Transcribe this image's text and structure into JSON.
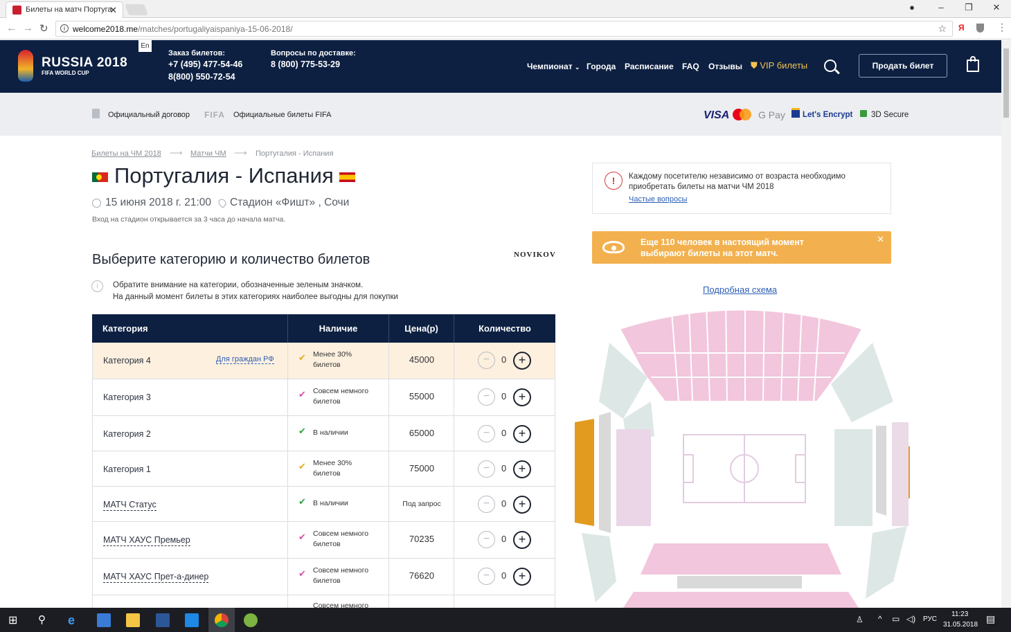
{
  "browser": {
    "tab_title": "Билеты на матч Португа",
    "url_host": "welcome2018.me",
    "url_path": "/matches/portugaliyaispaniya-15-06-2018/"
  },
  "header": {
    "logo_title": "RUSSIA 2018",
    "logo_subtitle": "FIFA WORLD CUP",
    "lang": "En",
    "order_label": "Заказ билетов:",
    "order_phone1": "+7 (495) 477-54-46",
    "order_phone2": "8(800) 550-72-54",
    "delivery_label": "Вопросы по доставке:",
    "delivery_phone": "8 (800) 775-53-29",
    "menu": [
      "Чемпионат",
      "Города",
      "Расписание",
      "FAQ",
      "Отзывы",
      "VIP билеты"
    ],
    "sell_button": "Продать билет"
  },
  "trust_bar": {
    "contract": "Официальный договор",
    "fifa_mark": "FIFA",
    "fifa_tickets": "Официальные билеты FIFA",
    "visa": "VISA",
    "gpay": "G Pay",
    "lets_encrypt": "Let's Encrypt",
    "secure3d": "3D Secure"
  },
  "breadcrumbs": [
    "Билеты на ЧМ 2018",
    "Матчи ЧМ",
    "Португалия - Испания"
  ],
  "match": {
    "title": "Португалия - Испания",
    "datetime": "15 июня 2018 г. 21:00",
    "stadium": "Стадион «Фишт» , Сочи",
    "entry_note": "Вход на стадион открывается за 3 часа до начала матча."
  },
  "choose_heading": "Выберите категорию и количество билетов",
  "sponsor": "NOVIKOV",
  "attention": {
    "line1": "Обратите внимание на категории, обозначенные зеленым значком.",
    "line2": "На данный момент билеты в этих категориях наиболее выгодны для покупки"
  },
  "table": {
    "headers": [
      "Категория",
      "Наличие",
      "Цена(р)",
      "Количество"
    ],
    "rf_link": "Для граждан РФ",
    "rows": [
      {
        "category": "Категория 4",
        "avail1": "Менее 30%",
        "avail2": "билетов",
        "price": "45000",
        "qty": "0"
      },
      {
        "category": "Категория 3",
        "avail1": "Совсем немного",
        "avail2": "билетов",
        "price": "55000",
        "qty": "0"
      },
      {
        "category": "Категория 2",
        "avail1": "В наличии",
        "avail2": "",
        "price": "65000",
        "qty": "0"
      },
      {
        "category": "Категория 1",
        "avail1": "Менее 30%",
        "avail2": "билетов",
        "price": "75000",
        "qty": "0"
      },
      {
        "category": "МАТЧ Статус",
        "avail1": "В наличии",
        "avail2": "",
        "price": "Под запрос",
        "qty": "0"
      },
      {
        "category": "МАТЧ ХАУС Премьер",
        "avail1": "Совсем немного",
        "avail2": "билетов",
        "price": "70235",
        "qty": "0"
      },
      {
        "category": "МАТЧ ХАУС Прет-а-динер",
        "avail1": "Совсем немного",
        "avail2": "билетов",
        "price": "76620",
        "qty": "0"
      },
      {
        "category": "",
        "avail1": "Совсем немного",
        "avail2": "",
        "price": "",
        "qty": ""
      }
    ]
  },
  "warning": {
    "line1": "Каждому посетителю независимо от возраста необходимо",
    "line2": "приобретать билеты на матчи ЧМ 2018",
    "link": "Частые вопросы"
  },
  "banner": {
    "line1": "Еще 110 человек в настоящий момент",
    "line2": "выбирают билеты на этот матч."
  },
  "schema_link": "Подробная схема",
  "taskbar": {
    "lang": "РУС",
    "time": "11:23",
    "date": "31.05.2018"
  },
  "colors": {
    "navy": "#0d2042",
    "orange": "#f2b14e",
    "pink": "#f2c6dc",
    "mint": "#dde8e6",
    "gold": "#e39b1f"
  }
}
